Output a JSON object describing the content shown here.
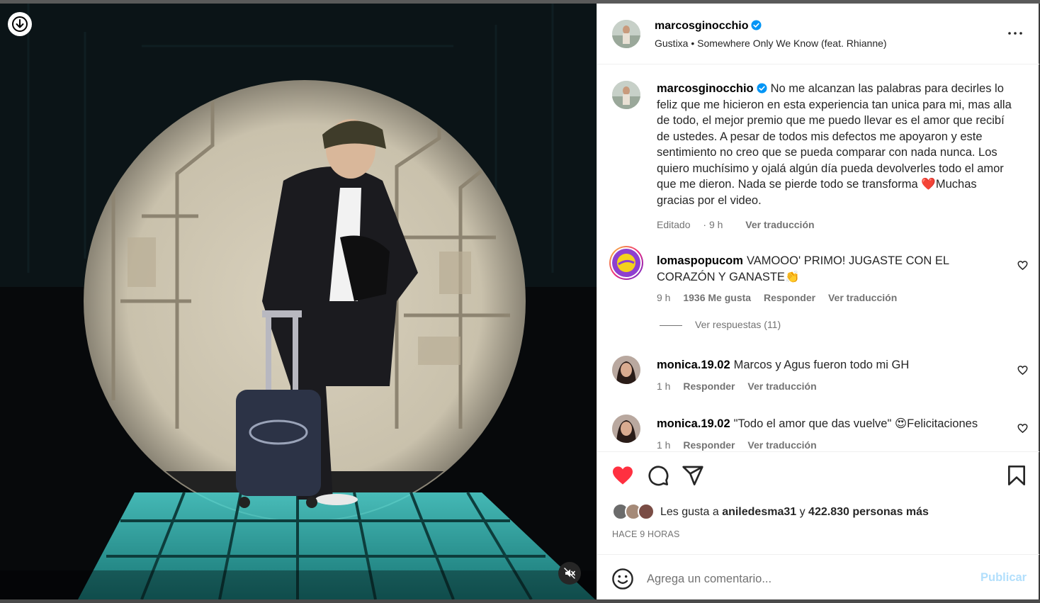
{
  "header": {
    "username": "marcosginocchio",
    "song": "Gustixa • Somewhere Only We Know (feat. Rhianne)"
  },
  "caption": {
    "username": "marcosginocchio",
    "text_1": "No me alcanzan las palabras para decirles lo feliz que me hicieron en esta experiencia tan unica para mi, mas alla de todo, el mejor premio que me puedo llevar es el amor que recibí de ustedes. A pesar de todos mis defectos me apoyaron y este sentimiento no creo que se pueda comparar con nada nunca. Los quiero muchísimo y ojalá algún día pueda devolverles todo el amor que me dieron. Nada se pierde todo se transforma ",
    "emoji": "❤️",
    "text_2": "Muchas gracias por el video.",
    "edited": "Editado",
    "time": "9 h",
    "translate": "Ver traducción"
  },
  "comments": [
    {
      "username": "lomaspopucom",
      "text_1": "VAMOOO' PRIMO! JUGASTE CON EL CORAZÓN Y GANASTE",
      "emoji": "👏",
      "time": "9 h",
      "likes": "1936 Me gusta",
      "reply": "Responder",
      "translate": "Ver traducción",
      "view_replies": "Ver respuestas (11)"
    },
    {
      "username": "monica.19.02",
      "text": "Marcos y Agus fueron todo mi GH",
      "time": "1 h",
      "reply": "Responder",
      "translate": "Ver traducción"
    },
    {
      "username": "monica.19.02",
      "text_1": "\"Todo el amor que das vuelve\" ",
      "emoji": "😍",
      "text_2": "Felicitaciones",
      "time": "1 h",
      "reply": "Responder",
      "translate": "Ver traducción"
    }
  ],
  "likes": {
    "prefix": "Les gusta a ",
    "user": "aniledesma31",
    "connector": " y ",
    "count": "422.830 personas más"
  },
  "post_time": "HACE 9 HORAS",
  "add_comment": {
    "placeholder": "Agrega un comentario...",
    "publish": "Publicar"
  },
  "colors": {
    "like_red": "#ff3040",
    "verified_blue": "#0095f6",
    "publish_disabled": "#b2dffc",
    "meta_gray": "#737373"
  },
  "icons": [
    "download-icon",
    "mute-icon",
    "more-icon",
    "verified-icon",
    "heart-icon",
    "comment-icon",
    "share-icon",
    "bookmark-icon",
    "emoji-icon"
  ]
}
